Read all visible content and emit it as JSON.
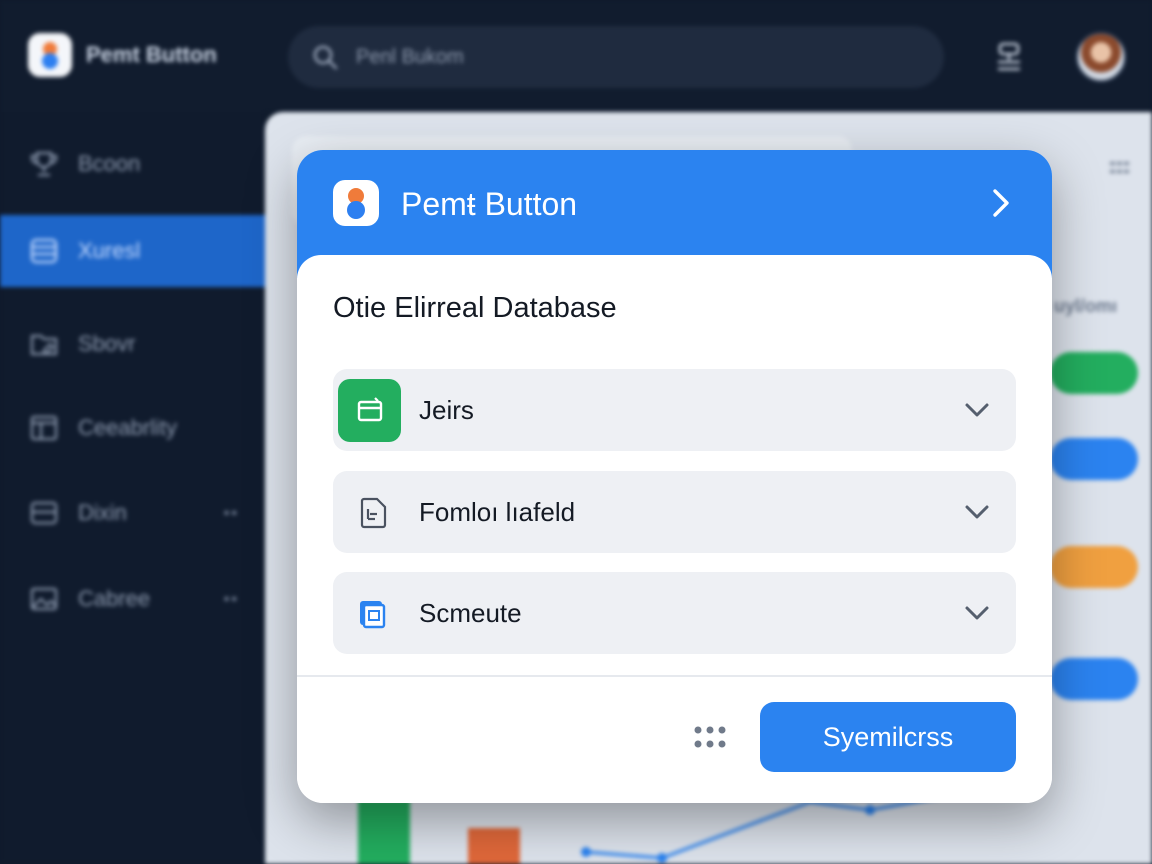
{
  "app": {
    "brand_title": "Pemt Button",
    "search_placeholder": "Penl Bukom"
  },
  "sidebar": {
    "items": [
      {
        "label": "Bcoon",
        "icon": "trophy-icon",
        "more": ""
      },
      {
        "label": "Xuresl",
        "icon": "database-icon",
        "more": ""
      },
      {
        "label": "Sbovr",
        "icon": "folder-edit-icon",
        "more": ""
      },
      {
        "label": "Ceeabrlity",
        "icon": "layout-icon",
        "more": ""
      },
      {
        "label": "Dixin",
        "icon": "panel-icon",
        "more": "••"
      },
      {
        "label": "Cabree",
        "icon": "image-icon",
        "more": "••"
      }
    ]
  },
  "content": {
    "side_label": "uyl/omı",
    "pill_colors": [
      "#23ae5f",
      "#2b83f0",
      "#f0a040",
      "#2b83f0"
    ]
  },
  "modal": {
    "title": "Pemŧ Button",
    "section_title": "Otie Elirreal Database",
    "rows": [
      {
        "label": "Jeirs",
        "icon": "calendar-icon"
      },
      {
        "label": "Fomloı lıafeld",
        "icon": "document-list-icon"
      },
      {
        "label": "Scmeute",
        "icon": "copy-icon"
      }
    ],
    "primary_button_label": "Syemilcrss"
  },
  "colors": {
    "accent": "#2b83f0",
    "success": "#23ae5f",
    "brand_orange": "#f07b3a",
    "sidebar_bg": "#101b2d",
    "sidebar_active": "#1e66c9"
  }
}
